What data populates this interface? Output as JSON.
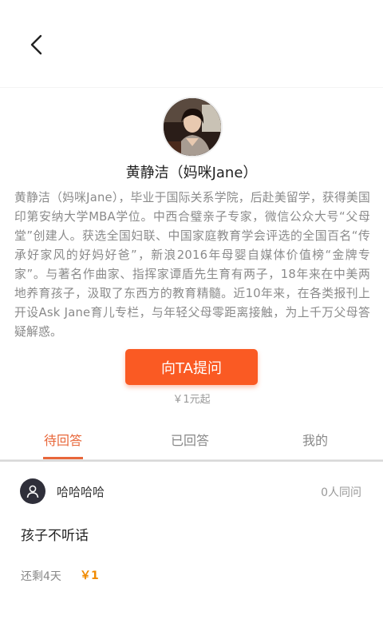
{
  "header": {
    "back_icon": "chevron-left-icon"
  },
  "profile": {
    "name": "黄静洁（妈咪Jane）",
    "bio": "黄静洁（妈咪Jane），毕业于国际关系学院，后赴美留学，获得美国印第安纳大学MBA学位。中西合璧亲子专家，微信公众大号“父母堂”创建人。获选全国妇联、中国家庭教育学会评选的全国百名“传承好家风的好妈好爸”，新浪2016年母婴自媒体价值榜“金牌专家”。与著名作曲家、指挥家谭盾先生育有两子，18年来在中美两地养育孩子，汲取了东西方的教育精髓。近10年来，在各类报刊上开设Ask Jane育儿专栏，与年轻父母零距离接触，为上千万父母答疑解惑。"
  },
  "ask": {
    "button_label": "向TA提问",
    "price_note": "￥1元起",
    "accent_color": "#fa5a23"
  },
  "tabs": [
    {
      "label": "待回答",
      "active": true
    },
    {
      "label": "已回答",
      "active": false
    },
    {
      "label": "我的",
      "active": false
    }
  ],
  "questions": [
    {
      "username": "哈哈哈哈",
      "agree_count": "0人同问",
      "question": "孩子不听话",
      "remaining": "还剩4天",
      "reward": "￥1",
      "avatar_icon": "user-icon"
    }
  ]
}
